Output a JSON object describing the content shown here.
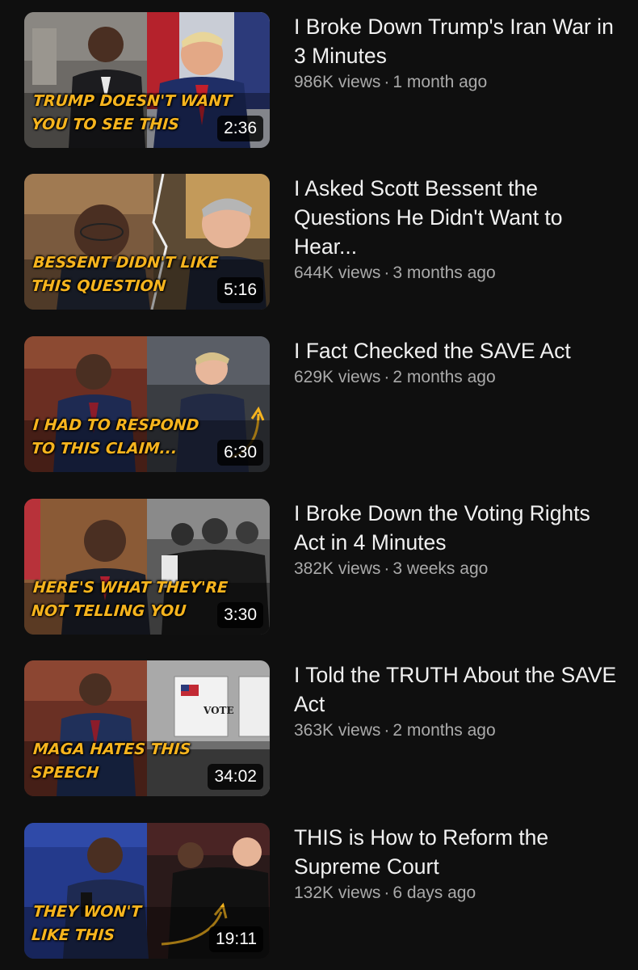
{
  "videos": [
    {
      "title": "I Broke Down Trump's Iran War in 3 Minutes",
      "views": "986K views",
      "age": "1 month ago",
      "duration": "2:36",
      "caption": "TRUMP DOESN'T WANT\nYOU TO SEE THIS"
    },
    {
      "title": "I Asked Scott Bessent the Questions He Didn't Want to Hear...",
      "views": "644K views",
      "age": "3 months ago",
      "duration": "5:16",
      "caption": "BESSENT DIDN'T LIKE\nTHIS QUESTION"
    },
    {
      "title": "I Fact Checked the SAVE Act",
      "views": "629K views",
      "age": "2 months ago",
      "duration": "6:30",
      "caption": "I HAD TO RESPOND\nTO THIS CLAIM..."
    },
    {
      "title": "I Broke Down the Voting Rights Act in 4 Minutes",
      "views": "382K views",
      "age": "3 weeks ago",
      "duration": "3:30",
      "caption": "HERE'S WHAT THEY'RE\nNOT TELLING YOU"
    },
    {
      "title": "I Told the TRUTH About the SAVE Act",
      "views": "363K views",
      "age": "2 months ago",
      "duration": "34:02",
      "caption": "MAGA HATES THIS\nSPEECH"
    },
    {
      "title": "THIS is How to Reform the Supreme Court",
      "views": "132K views",
      "age": "6 days ago",
      "duration": "19:11",
      "caption": "THEY WON'T\nLIKE THIS"
    }
  ],
  "separator": "·",
  "colors": {
    "background": "#0f0f0f",
    "title": "#f1f1f1",
    "meta": "#aaaaaa",
    "caption": "#f6b41e"
  }
}
